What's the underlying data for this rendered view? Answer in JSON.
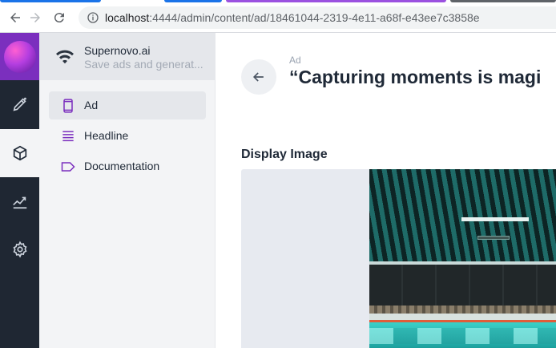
{
  "browser": {
    "url_host": "localhost",
    "url_rest": ":4444/admin/content/ad/18461044-2319-4e11-a68f-e43ee7c3858e",
    "tab_colors": [
      "#1a73e8",
      "#1a73e8",
      "#9b51e0",
      "#5f6368"
    ]
  },
  "rail": {
    "items": [
      {
        "icon": "pencil-icon",
        "active": false
      },
      {
        "icon": "cube-icon",
        "active": true
      },
      {
        "icon": "chart-icon",
        "active": false
      },
      {
        "icon": "gear-icon",
        "active": false
      }
    ]
  },
  "sidebar": {
    "title": "Supernovo.ai",
    "subtitle": "Save ads and generat...",
    "items": [
      {
        "label": "Ad",
        "icon": "phone-icon",
        "active": true
      },
      {
        "label": "Headline",
        "icon": "list-icon",
        "active": false
      },
      {
        "label": "Documentation",
        "icon": "tag-icon",
        "active": false
      }
    ]
  },
  "main": {
    "kicker": "Ad",
    "title": "“Capturing moments is magi",
    "field_label": "Display Image"
  },
  "colors": {
    "accent": "#7b2fbe",
    "rail_bg": "#1f2733",
    "sidebar_bg": "#f3f4f6"
  }
}
